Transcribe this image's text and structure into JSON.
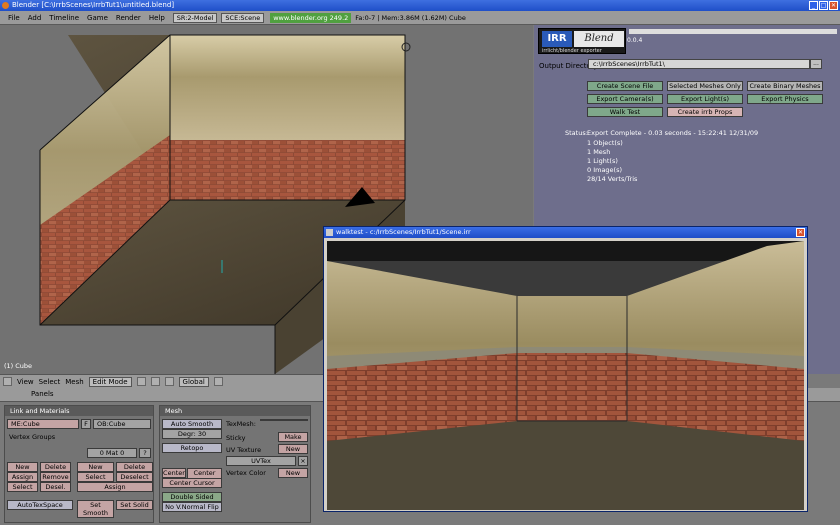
{
  "window": {
    "title": "Blender [C:\\IrrbScenes\\IrrbTut1\\untitled.blend]",
    "controls": [
      "_",
      "□",
      "✕"
    ]
  },
  "menubar": {
    "items": [
      "File",
      "Add",
      "Timeline",
      "Game",
      "Render",
      "Help"
    ],
    "screen": "SR:2-Model",
    "scene": "SCE:Scene",
    "url": "www.blender.org 249.2",
    "info": "Fa:0-7 | Mem:3.86M (1.62M) Cube"
  },
  "viewport": {
    "object_label": "(1) Cube"
  },
  "viewport_header": {
    "view": "View",
    "select": "Select",
    "mesh": "Mesh",
    "mode": "Edit Mode",
    "orientation": "Global"
  },
  "irr": {
    "logo_left": "IRR",
    "logo_right": "Blend",
    "logo_sub": "irrlicht/blender exporter",
    "version": "0.0.4",
    "output_label": "Output Directory",
    "output_value": "c:\\IrrbScenes\\IrrbTut1\\",
    "browse": "...",
    "buttons": {
      "create_scene": "Create Scene File",
      "selected_meshes": "Selected Meshes Only",
      "create_binary": "Create Binary Meshes",
      "export_cameras": "Export Camera(s)",
      "export_lights": "Export Light(s)",
      "export_physics": "Export Physics",
      "walk_test": "Walk Test",
      "create_irrb_props": "Create irrb Props"
    },
    "status_label": "Status:",
    "status_lines": [
      "Export Complete - 0.03 seconds - 15:22:41 12/31/09",
      "1 Object(s)",
      "1 Mesh",
      "1 Light(s)",
      "0 Image(s)",
      "28/14 Verts/Tris"
    ]
  },
  "buttons_window": {
    "panels_label": "Panels",
    "link_materials": {
      "title": "Link and Materials",
      "me": "ME:Cube",
      "f": "F",
      "ob": "OB:Cube",
      "vertex_groups": "Vertex Groups",
      "mat": "0 Mat 0",
      "q": "?",
      "new": "New",
      "delete": "Delete",
      "assign": "Assign",
      "remove": "Remove",
      "select": "Select",
      "deselect": "Desel.",
      "new2": "New",
      "delete2": "Delete",
      "select2": "Select",
      "deselect2": "Deselect",
      "assign2": "Assign",
      "autotexspace": "AutoTexSpace",
      "set_smooth": "Set Smooth",
      "set_solid": "Set Solid"
    },
    "mesh": {
      "title": "Mesh",
      "auto_smooth": "Auto Smooth",
      "degr": "Degr: 30",
      "retopo": "Retopo",
      "texmesh": "TexMesh:",
      "sticky": "Sticky",
      "make": "Make",
      "uv_texture": "UV Texture",
      "new": "New",
      "uvtex": "UVTex",
      "vertex_color": "Vertex Color",
      "new2": "New",
      "center": "Center",
      "center_new": "Center New",
      "center_cursor": "Center Cursor",
      "double_sided": "Double Sided",
      "no_vnormal": "No V.Normal Flip"
    }
  },
  "walktest": {
    "title": "walktest - c:/IrrbScenes/IrrbTut1/Scene.irr",
    "close": "✕"
  }
}
